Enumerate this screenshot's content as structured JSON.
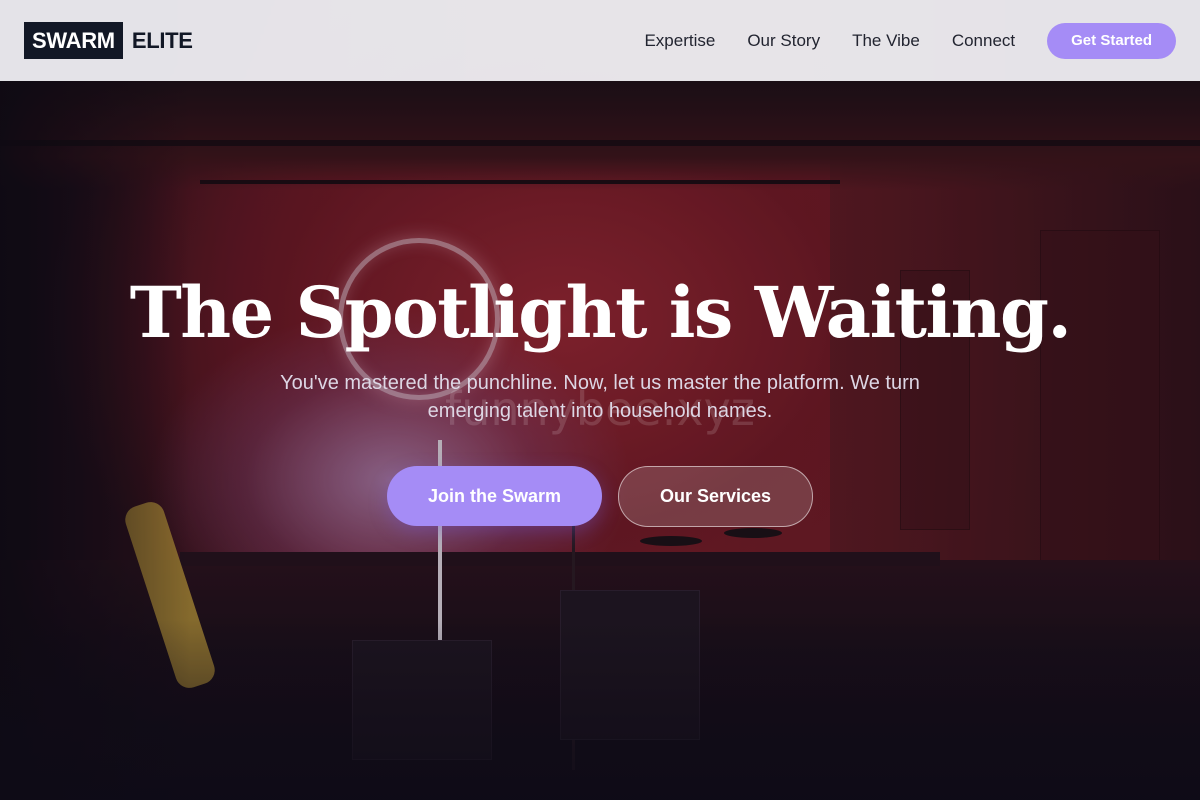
{
  "brand": {
    "logo_box": "SWARM",
    "logo_text": "ELITE"
  },
  "nav": {
    "links": [
      "Expertise",
      "Our Story",
      "The Vibe",
      "Connect"
    ],
    "cta_label": "Get Started"
  },
  "hero": {
    "headline": "The Spotlight is Waiting.",
    "subtitle": "You've mastered the punchline. Now, let us master the platform. We turn emerging talent into household names.",
    "primary_button": "Join the Swarm",
    "secondary_button": "Our Services",
    "watermark": "funnybee.xyz"
  },
  "colors": {
    "accent": "#a58cf6",
    "logo_dark": "#121826",
    "navbar_bg": "#ececf0"
  }
}
